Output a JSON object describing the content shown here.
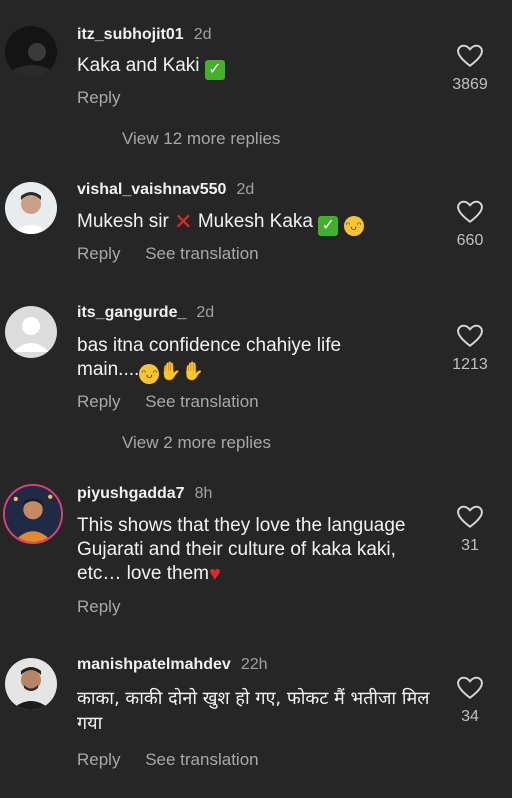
{
  "comments": [
    {
      "username": "itz_subhojit01",
      "time": "2d",
      "text": "Kaka and Kaki",
      "reply_label": "Reply",
      "likes": "3869",
      "more_replies": "View 12 more replies"
    },
    {
      "username": "vishal_vaishnav550",
      "time": "2d",
      "text_a": "Mukesh sir",
      "text_b": "Mukesh Kaka",
      "reply_label": "Reply",
      "translate_label": "See translation",
      "likes": "660"
    },
    {
      "username": "its_gangurde_",
      "time": "2d",
      "text_line1": "bas itna confidence chahiye life",
      "text_line2": "main....",
      "reply_label": "Reply",
      "translate_label": "See translation",
      "likes": "1213",
      "more_replies": "View 2 more replies"
    },
    {
      "username": "piyushgadda7",
      "time": "8h",
      "text": "This shows that they love the language Gujarati and their culture of kaka kaki, etc… love them",
      "reply_label": "Reply",
      "likes": "31"
    },
    {
      "username": "manishpatelmahdev",
      "time": "22h",
      "text": "काका, काकी दोनो खुश हो गए, फोकट मैं भतीजा मिल गया",
      "reply_label": "Reply",
      "translate_label": "See translation",
      "likes": "34"
    }
  ],
  "icons": {
    "like": "heart-outline-icon",
    "check": "check-mark-emoji",
    "cross": "cross-mark-emoji",
    "laugh": "tears-of-joy-emoji",
    "hands": "raised-hands-emoji",
    "heart": "red-heart-emoji"
  }
}
